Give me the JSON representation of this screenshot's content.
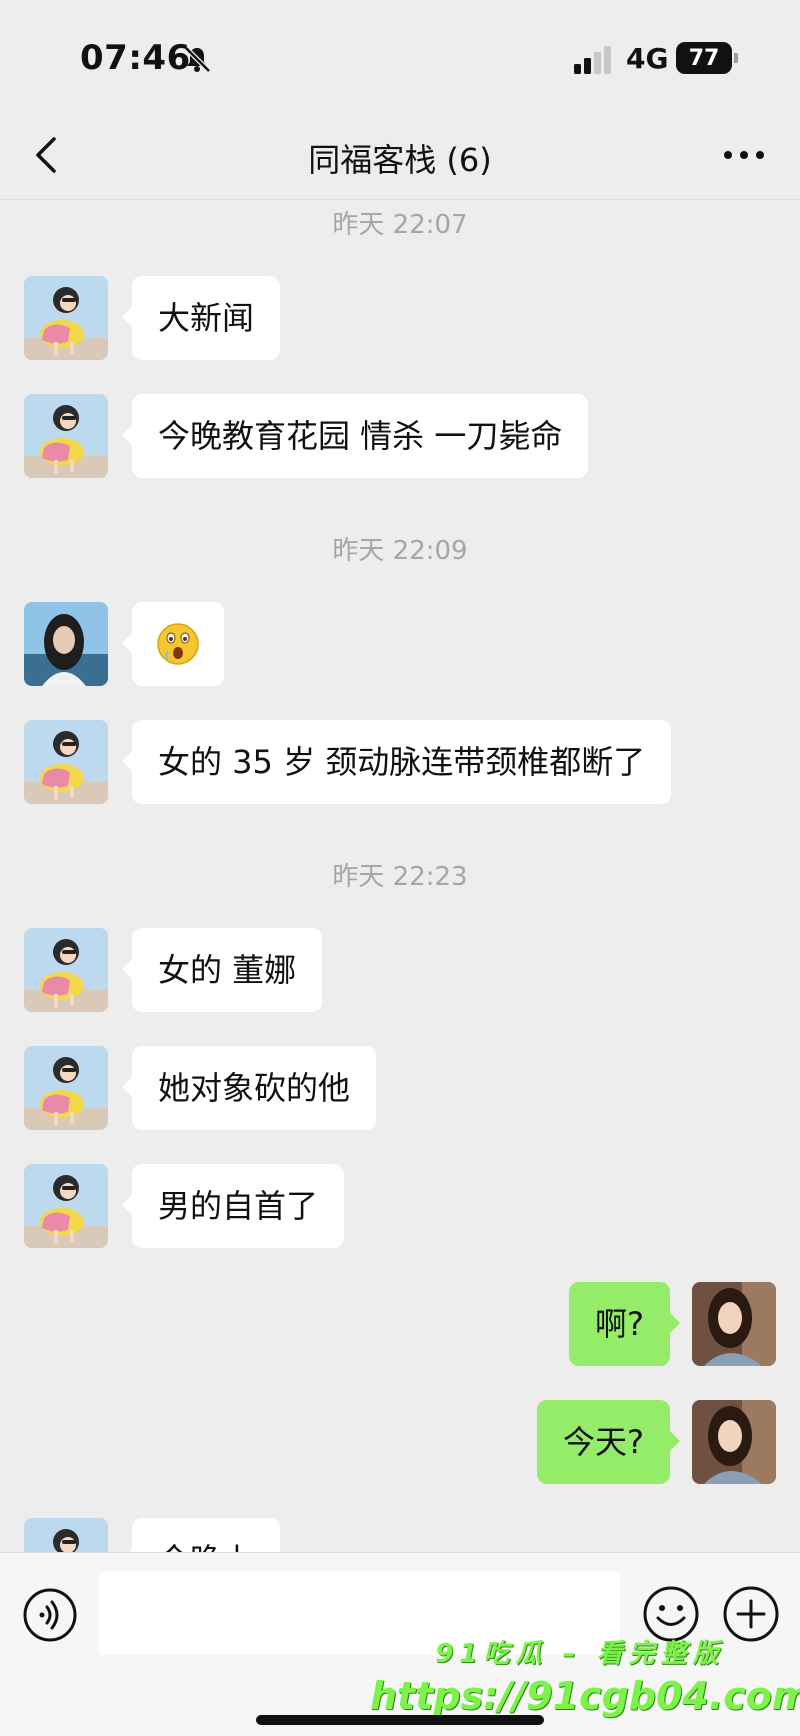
{
  "status_bar": {
    "time": "07:46",
    "network": "4G",
    "battery": "77"
  },
  "nav": {
    "title": "同福客栈 (6)"
  },
  "timestamps": [
    "昨天 22:07",
    "昨天 22:09",
    "昨天 22:23"
  ],
  "messages": [
    {
      "side": "in",
      "text": "大新闻"
    },
    {
      "side": "in",
      "text": "今晚教育花园 情杀 一刀毙命"
    },
    {
      "side": "in",
      "text": "",
      "emoji": "surprised-face-emoji"
    },
    {
      "side": "in",
      "text": "女的 35 岁 颈动脉连带颈椎都断了"
    },
    {
      "side": "in",
      "text": "女的 董娜"
    },
    {
      "side": "in",
      "text": "她对象砍的他"
    },
    {
      "side": "in",
      "text": "男的自首了"
    },
    {
      "side": "out",
      "text": "啊?"
    },
    {
      "side": "out",
      "text": "今天?"
    },
    {
      "side": "in",
      "text": "今晚上"
    }
  ],
  "input": {
    "placeholder": ""
  },
  "watermark": {
    "line1": "91吃瓜 – 看完整版",
    "line2": "https://91cgb04.com"
  },
  "colors": {
    "background": "#ededed",
    "outgoing_bubble": "#95ec69",
    "incoming_bubble": "#ffffff"
  }
}
